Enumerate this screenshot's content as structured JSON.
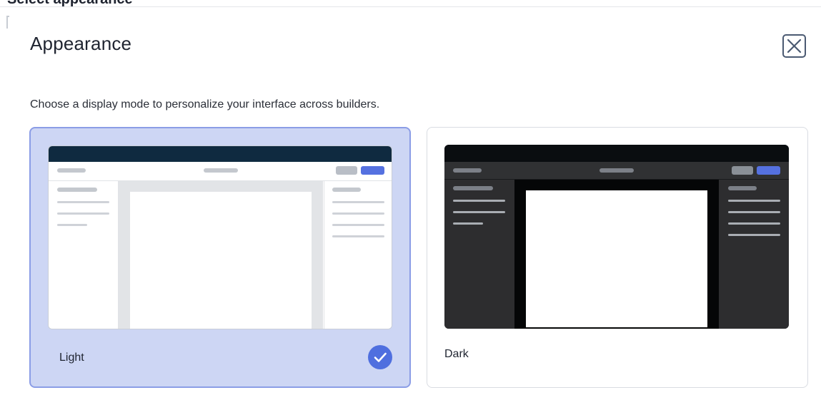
{
  "header": {
    "partial_title": "Select appearance"
  },
  "modal": {
    "title": "Appearance",
    "description": "Choose a display mode to personalize your interface across builders.",
    "close_icon": "close-icon"
  },
  "options": [
    {
      "label": "Light",
      "selected": true,
      "preview": "light-mode-preview"
    },
    {
      "label": "Dark",
      "selected": false,
      "preview": "dark-mode-preview"
    }
  ],
  "colors": {
    "accent": "#4f6fdf",
    "selected_card_bg": "#cdd6f4",
    "selected_card_border": "#8b9de6",
    "light_preview_header": "#0f2a40",
    "dark_preview_header": "#0a0d10",
    "dark_preview_body": "#2d2d2f"
  }
}
